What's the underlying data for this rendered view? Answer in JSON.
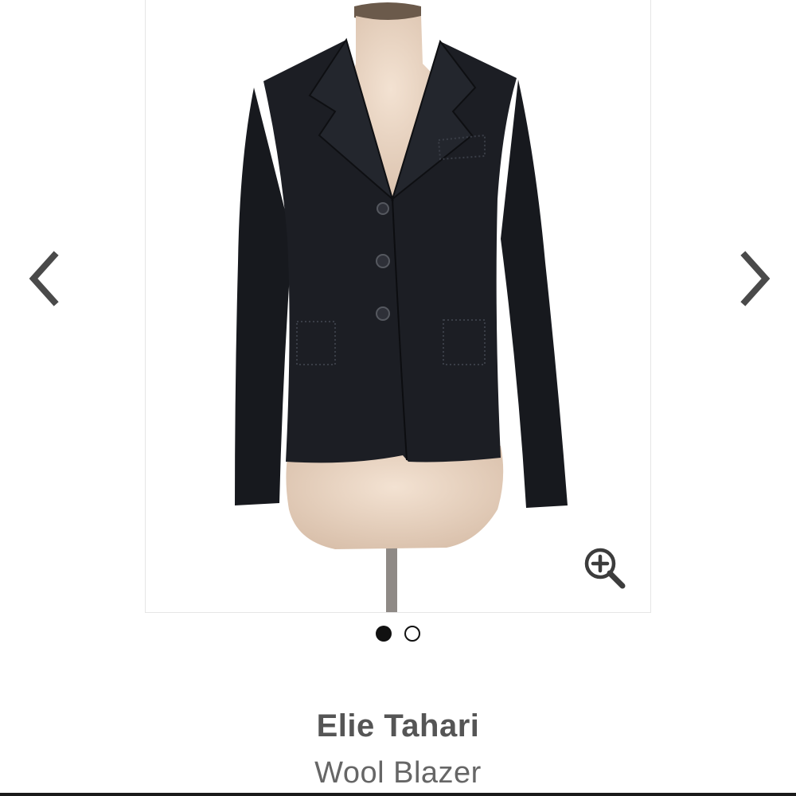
{
  "gallery": {
    "prev_icon": "chevron-left-icon",
    "next_icon": "chevron-right-icon",
    "zoom_icon": "zoom-in-icon",
    "slide_count": 2,
    "active_slide": 1
  },
  "product": {
    "brand": "Elie Tahari",
    "name": "Wool Blazer"
  },
  "colors": {
    "arrow": "#4a4a4a",
    "dot_active": "#111111",
    "brand_text": "#555555",
    "name_text": "#666666"
  }
}
